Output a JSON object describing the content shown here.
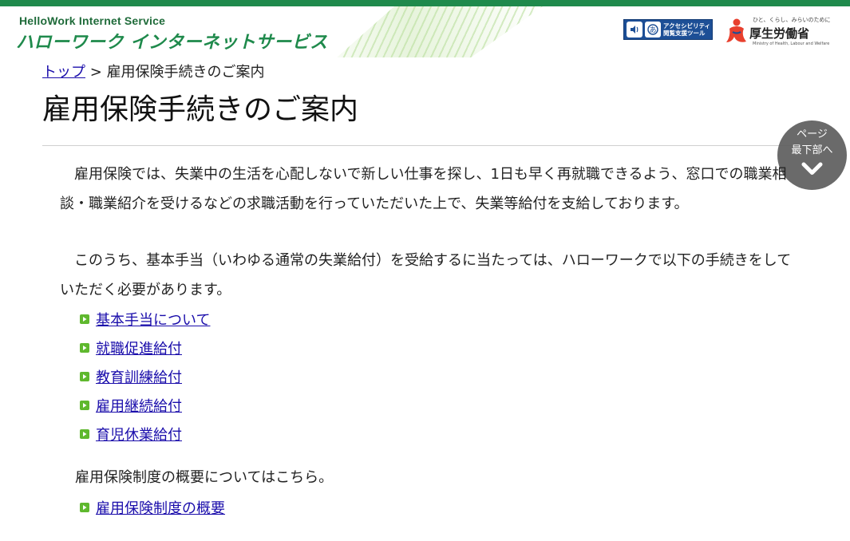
{
  "header": {
    "logo_sub": "HelloWork Internet Service",
    "logo_main": "ハローワーク インターネットサービス",
    "accessibility_button": "アクセシビリティ\n閲覧支援ツール",
    "ministry_tagline": "ひと、くらし、みらいのために",
    "ministry_name": "厚生労働省",
    "ministry_english": "Ministry of Health, Labour and Welfare"
  },
  "breadcrumb": {
    "home": "トップ",
    "separator": ">",
    "current": "雇用保険手続きのご案内"
  },
  "page_title": "雇用保険手続きのご案内",
  "scroll_button": {
    "line1": "ページ",
    "line2": "最下部へ"
  },
  "content": {
    "paragraph1": "雇用保険では、失業中の生活を心配しないで新しい仕事を探し、1日も早く再就職できるよう、窓口での職業相談・職業紹介を受けるなどの求職活動を行っていただいた上で、失業等給付を支給しております。",
    "paragraph2": "このうち、基本手当（いわゆる通常の失業給付）を受給するに当たっては、ハローワークで以下の手続きをしていただく必要があります。",
    "links": [
      "基本手当について",
      "就職促進給付",
      "教育訓練給付",
      "雇用継続給付",
      "育児休業給付"
    ],
    "overview_note": "雇用保険制度の概要についてはこちら。",
    "overview_link": "雇用保険制度の概要"
  },
  "colors": {
    "brand_green": "#1f8a4c",
    "link_blue": "#1a0dab",
    "bullet_green": "#5fb82e",
    "access_blue": "#1d4f96"
  }
}
